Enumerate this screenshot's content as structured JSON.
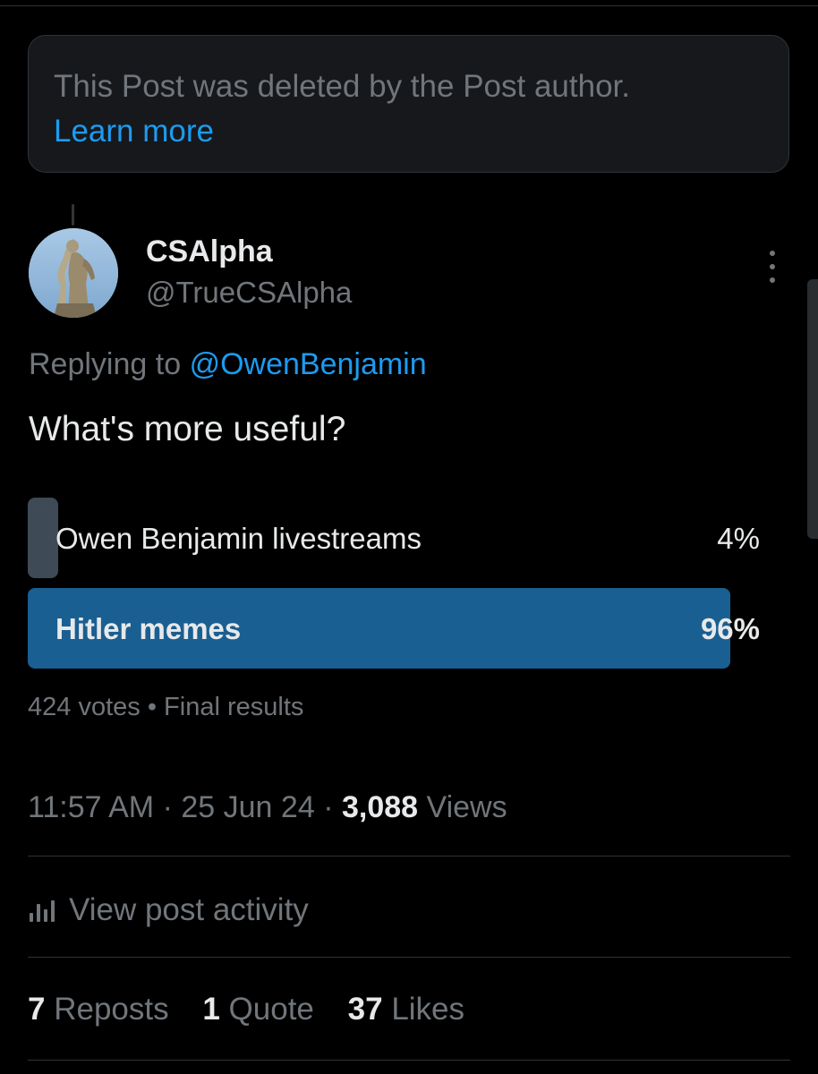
{
  "deleted_notice": {
    "text": "This Post was deleted by the Post author.",
    "link": "Learn more"
  },
  "post": {
    "display_name": "CSAlpha",
    "handle": "@TrueCSAlpha",
    "replying_prefix": "Replying to",
    "replying_to": "@OwenBenjamin",
    "text": "What's more useful?",
    "avatar_icon": "statue-avatar",
    "more_icon": "more-options-icon"
  },
  "poll": {
    "options": [
      {
        "label": "Owen Benjamin livestreams",
        "percent": "4%",
        "fraction": 0.04,
        "winner": false
      },
      {
        "label": "Hitler memes",
        "percent": "96%",
        "fraction": 0.96,
        "winner": true
      }
    ],
    "votes": "424 votes",
    "separator": "•",
    "status": "Final results"
  },
  "meta": {
    "time": "11:57 AM",
    "date": "25 Jun 24",
    "sep": "·",
    "views_count": "3,088",
    "views_label": "Views"
  },
  "activity": {
    "label": "View post activity",
    "icon": "bar-chart-icon"
  },
  "stats": {
    "reposts_count": "7",
    "reposts_label": "Reposts",
    "quotes_count": "1",
    "quotes_label": "Quote",
    "likes_count": "37",
    "likes_label": "Likes"
  },
  "colors": {
    "background": "#000000",
    "text": "#e7e9ea",
    "muted": "#71767b",
    "link": "#1d9bf0",
    "winner_bar": "#1a5f91",
    "loser_bar": "#3e4a55"
  }
}
